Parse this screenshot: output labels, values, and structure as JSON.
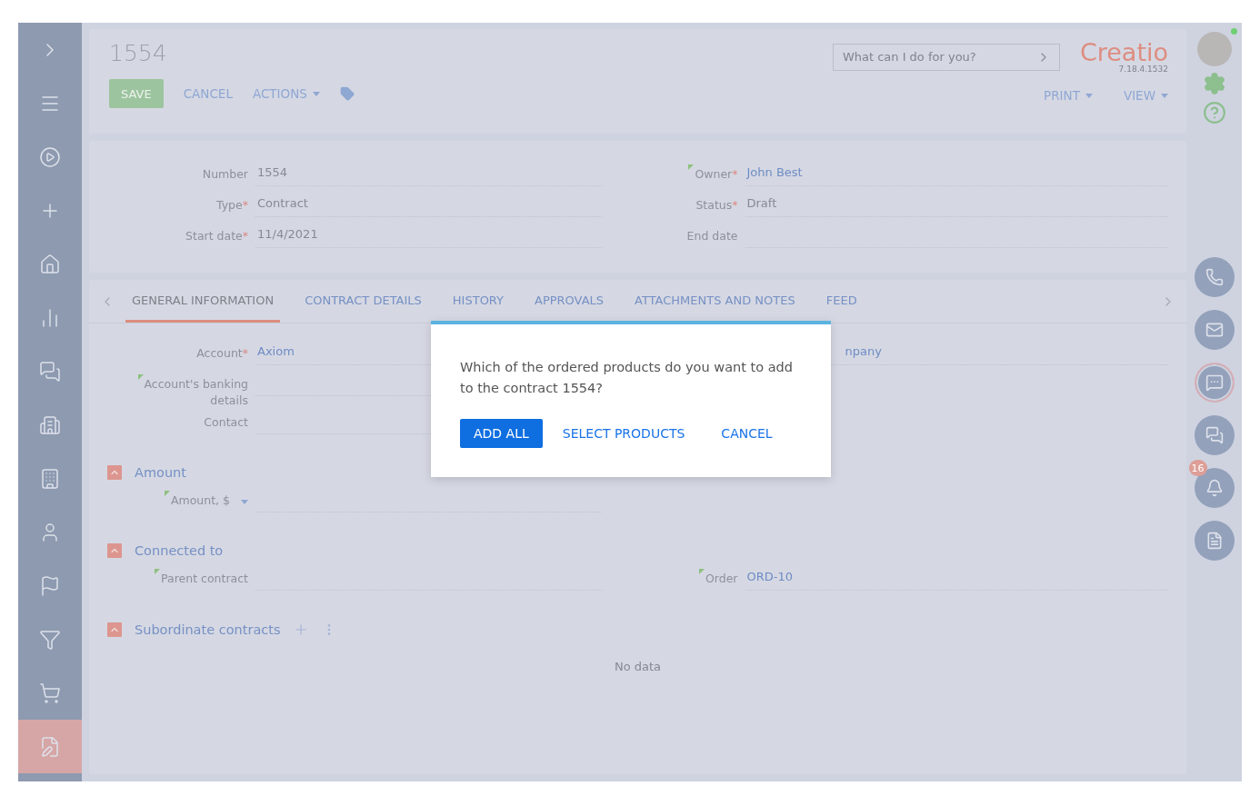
{
  "sidebar": {
    "items": [
      {
        "selected": false
      },
      {
        "selected": false
      },
      {
        "selected": false
      },
      {
        "selected": false
      },
      {
        "selected": false
      },
      {
        "selected": false
      },
      {
        "selected": false
      },
      {
        "selected": false
      },
      {
        "selected": false
      },
      {
        "selected": false
      },
      {
        "selected": false
      },
      {
        "selected": false
      },
      {
        "selected": false
      },
      {
        "selected": true
      }
    ]
  },
  "header": {
    "title": "1554",
    "save": "SAVE",
    "cancel": "CANCEL",
    "actions": "ACTIONS",
    "search": {
      "placeholder": "What can I do for you?"
    },
    "logo": "Creatio",
    "version": "7.18.4.1532",
    "print": "PRINT",
    "view": "VIEW"
  },
  "fields": {
    "left": [
      {
        "label": "Number",
        "value": "1554",
        "link": false
      },
      {
        "label": "Type",
        "required": "*",
        "value": "Contract",
        "link": false
      },
      {
        "label": "Start date",
        "required": "*",
        "value": "11/4/2021",
        "link": false
      }
    ],
    "right": [
      {
        "label": "Owner",
        "required": "*",
        "marked": true,
        "value": "John Best",
        "link": true
      },
      {
        "label": "Status",
        "required": "*",
        "value": "Draft",
        "link": false
      },
      {
        "label": "End date"
      }
    ]
  },
  "tabs": [
    {
      "label": "GENERAL INFORMATION",
      "selected": true
    },
    {
      "label": "CONTRACT DETAILS",
      "selected": false
    },
    {
      "label": "HISTORY",
      "selected": false
    },
    {
      "label": "APPROVALS",
      "selected": false
    },
    {
      "label": "ATTACHMENTS AND NOTES",
      "selected": false
    },
    {
      "label": "FEED",
      "selected": false
    }
  ],
  "general": {
    "left": [
      {
        "label": "Account",
        "required": "*",
        "value": "Axiom",
        "link": true
      },
      {
        "label": "Account's banking details",
        "marked": true
      },
      {
        "label": "Contact"
      }
    ],
    "right_value": "npany"
  },
  "sections": [
    {
      "title": "Amount",
      "expanded": true,
      "fields": [
        {
          "label": "Amount, $",
          "marked": true,
          "dropdown": true
        }
      ]
    },
    {
      "title": "Connected to",
      "expanded": true,
      "fields": [
        {
          "label": "Parent contract",
          "marked": true
        },
        {
          "label": "Order",
          "marked": true,
          "value": "ORD-10",
          "link": true
        }
      ]
    },
    {
      "title": "Subordinate contracts",
      "expanded": true,
      "tools": true,
      "empty": "No data"
    }
  ],
  "dialog": {
    "message": "Which of the ordered products do you want to add to the contract 1554?",
    "buttons": [
      {
        "label": "ADD ALL",
        "kind": "primary"
      },
      {
        "label": "SELECT PRODUCTS",
        "kind": "link"
      },
      {
        "label": "CANCEL",
        "kind": "link"
      }
    ]
  },
  "rightbar": {
    "online": true,
    "buttons": [
      {
        "selected": false
      },
      {
        "selected": false
      },
      {
        "selected": true
      },
      {
        "selected": false
      },
      {
        "selected": false,
        "badge": "16"
      },
      {
        "selected": false
      }
    ]
  }
}
